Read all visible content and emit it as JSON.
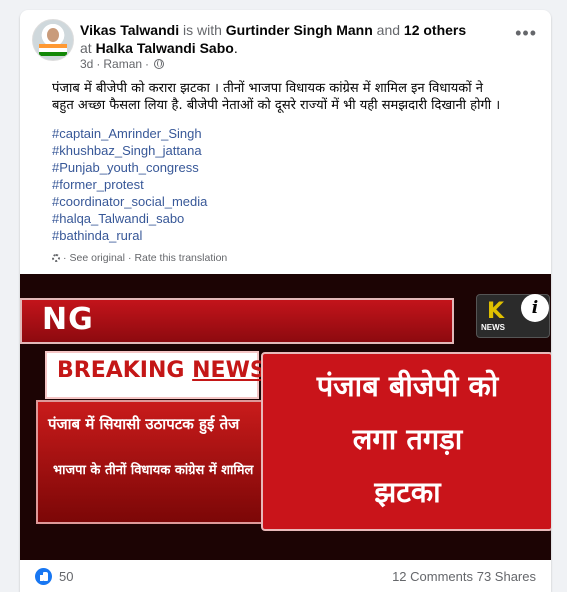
{
  "post": {
    "author": "Vikas Talwandi",
    "with_text": "is with",
    "tagged_person": "Gurtinder Singh Mann",
    "and_text": "and",
    "others": "12 others",
    "at_text": "at",
    "location": "Halka Talwandi Sabo",
    "location_suffix": ".",
    "time": "3d",
    "location_short": "Raman",
    "separator": "·",
    "more_menu": "•••",
    "text_line1": "पंजाब में बीजेपी को करारा झटका । तीनों भाजपा विधायक कांग्रेस में शामिल इन विधायकों ने",
    "text_line2": "बहुत अच्छा फैसला लिया है. बीजेपी नेताओं को दूसरे राज्यों में भी यही समझदारी दिखानी होगी ।",
    "hashtags": [
      "#captain_Amrinder_Singh",
      "#khushbaz_Singh_jattana",
      "#Punjab_youth_congress",
      "#former_protest",
      "#coordinator_social_media",
      "#halqa_Talwandi_sabo",
      "#bathinda_rural"
    ],
    "see_original": "See original",
    "rate_translation": "Rate this translation"
  },
  "image": {
    "ng_text": "NG",
    "logo_k": "K",
    "logo_news": "NEWS",
    "info": "i",
    "breaking_1": "BREAKING",
    "breaking_2": "NEWS",
    "left_line1": "पंजाब में सियासी उठापटक हुई तेज",
    "left_line2": "भाजपा के तीनों विधायक कांग्रेस में शामिल",
    "right_line1": "पंजाब बीजेपी को",
    "right_line2": "लगा तगड़ा",
    "right_line3": "झटका"
  },
  "footer": {
    "likes": "50",
    "comments": "12 Comments",
    "shares": "73 Shares"
  }
}
